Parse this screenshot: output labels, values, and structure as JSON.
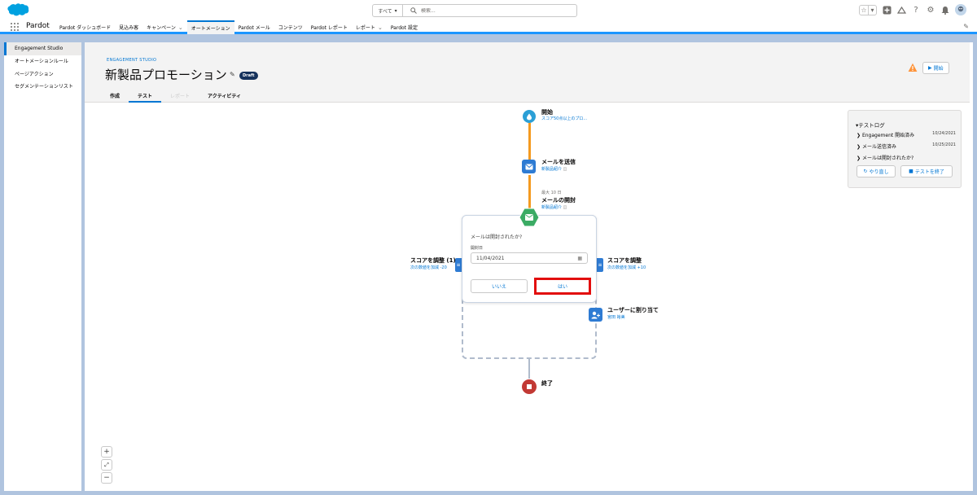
{
  "header": {
    "search_scope": "すべて",
    "search_placeholder": "検索..."
  },
  "nav": {
    "app_name": "Pardot",
    "items": [
      {
        "label": "Pardot ダッシュボード"
      },
      {
        "label": "見込み客"
      },
      {
        "label": "キャンペーン"
      },
      {
        "label": "オートメーション"
      },
      {
        "label": "Pardot メール"
      },
      {
        "label": "コンテンツ"
      },
      {
        "label": "Pardot レポート"
      },
      {
        "label": "レポート"
      },
      {
        "label": "Pardot 設定"
      }
    ]
  },
  "sidebar": {
    "items": [
      {
        "label": "Engagement Studio"
      },
      {
        "label": "オートメーションルール"
      },
      {
        "label": "ページアクション"
      },
      {
        "label": "セグメンテーションリスト"
      }
    ]
  },
  "page": {
    "eyebrow": "ENGAGEMENT STUDIO",
    "title": "新製品プロモーション",
    "badge": "Draft",
    "start_button": "開始",
    "tabs": [
      {
        "label": "作成"
      },
      {
        "label": "テスト"
      },
      {
        "label": "レポート"
      },
      {
        "label": "アクティビティ"
      }
    ]
  },
  "flow": {
    "start": {
      "label": "開始",
      "sub": "スコア50点以上のプロ..."
    },
    "send_email": {
      "label": "メールを送信",
      "sub": "新製品紹介"
    },
    "open_email": {
      "meta": "最大 10 日",
      "label": "メールの開封",
      "sub": "新製品紹介"
    },
    "question": "メールは開封されたか?",
    "date_label": "開封日",
    "date_value": "11/04/2021",
    "no_button": "いいえ",
    "yes_button": "はい",
    "adjust_left": {
      "label": "スコアを調整 (1)",
      "sub": "次の数値を加減 -20"
    },
    "adjust_right": {
      "label": "スコアを調整",
      "sub": "次の数値を加減 +10"
    },
    "assign_user": {
      "label": "ユーザーに割り当て",
      "sub": "宮田 裕美"
    },
    "end": {
      "label": "終了"
    }
  },
  "testlog": {
    "title": "テストログ",
    "rows": [
      {
        "label": "Engagement 開始済み",
        "date": "10/24/2021"
      },
      {
        "label": "メール送信済み",
        "date": "10/25/2021"
      },
      {
        "label": "メールは開封されたか?",
        "date": ""
      }
    ],
    "undo_button": "やり直し",
    "end_test_button": "テストを終了"
  },
  "colors": {
    "accent": "#0176d3",
    "flow_line": "#f49a20",
    "start_node": "#2b9fd6",
    "email_node": "#2e7bd3",
    "open_node": "#3bab64",
    "end_node": "#c23934",
    "highlight": "#e20e0e"
  }
}
